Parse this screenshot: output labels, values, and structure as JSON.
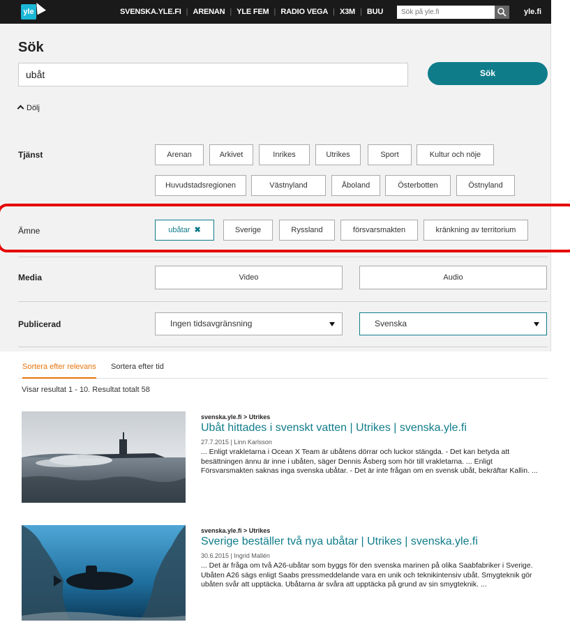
{
  "topbar": {
    "logo": "yle",
    "nav": [
      "SVENSKA.YLE.FI",
      "ARENAN",
      "YLE FEM",
      "RADIO VEGA",
      "X3M",
      "BUU"
    ],
    "search_placeholder": "Sök på yle.fi",
    "site_link": "yle.fi"
  },
  "search": {
    "title": "Sök",
    "query": "ubåt",
    "button_label": "Sök",
    "hide_label": "Dölj"
  },
  "filters": {
    "tjanst": {
      "label": "Tjänst",
      "options": [
        "Arenan",
        "Arkivet",
        "Inrikes",
        "Utrikes",
        "Sport",
        "Kultur och nöje",
        "Huvudstadsregionen",
        "Västnyland",
        "Åboland",
        "Österbotten",
        "Östnyland"
      ]
    },
    "amne": {
      "label": "Ämne",
      "options": [
        "ubåtar",
        "Sverige",
        "Ryssland",
        "försvarsmakten",
        "kränkning av territorium"
      ],
      "active_remove_icon": "✖"
    },
    "media": {
      "label": "Media",
      "options": [
        "Video",
        "Audio"
      ]
    },
    "publicerad": {
      "label": "Publicerad",
      "time_select": "Ingen tidsavgränsning",
      "language_select": "Svenska"
    }
  },
  "results": {
    "sort_tabs": [
      "Sortera efter relevans",
      "Sortera efter tid"
    ],
    "count_text": "Visar resultat 1 - 10. Resultat totalt 58",
    "items": [
      {
        "source": "svenska.yle.fi > Utrikes",
        "title": "Ubåt hittades i svenskt vatten | Utrikes | svenska.yle.fi",
        "byline": "27.7.2015 | Linn Karlsson",
        "snippet": "... Enligt vrakletarna i Ocean X Team är ubåtens dörrar och luckor stängda. - Det kan betyda att besättningen ännu är inne i ubåten, säger Dennis Åsberg som hör till vrakletarna. ... Enligt Försvarsmakten saknas inga svenska ubåtar. - Det är inte frågan om en svensk ubåt, bekräftar Kallin. ..."
      },
      {
        "source": "svenska.yle.fi > Utrikes",
        "title": "Sverige beställer två nya ubåtar | Utrikes | svenska.yle.fi",
        "byline": "30.6.2015 | Ingrid Mallén",
        "snippet": "... Det är fråga om två A26-ubåtar som byggs för den svenska marinen på olika Saabfabriker i Sverige. Ubåten A26 sägs enligt Saabs pressmeddelande vara en unik och teknikintensiv ubåt. Smygteknik gör ubåten svår att upptäcka. Ubåtarna är svåra att upptäcka på grund av sin smygteknik. ..."
      }
    ]
  },
  "colors": {
    "accent": "#0f7c8a",
    "sort_active": "#e8730c",
    "highlight_box": "#e60000",
    "topbar": "#1a1a1a"
  }
}
